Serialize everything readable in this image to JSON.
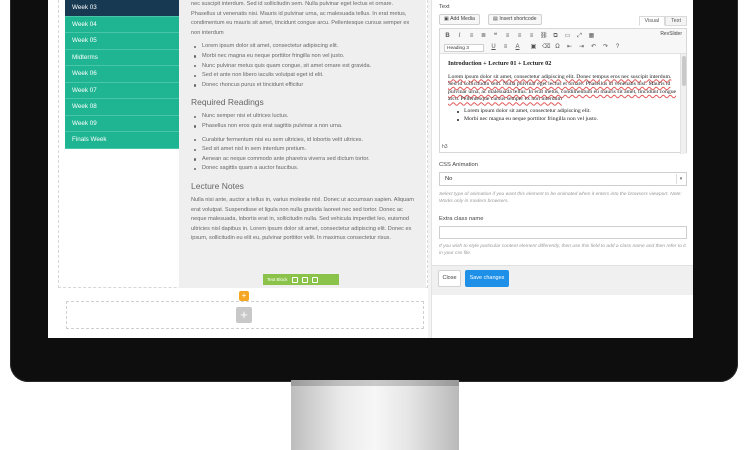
{
  "sidebar": {
    "weeks": [
      {
        "label": "Week 03",
        "active": true
      },
      {
        "label": "Week 04"
      },
      {
        "label": "Week 05"
      },
      {
        "label": "Midterms"
      },
      {
        "label": "Week 06"
      },
      {
        "label": "Week 07"
      },
      {
        "label": "Week 08"
      },
      {
        "label": "Week 09"
      },
      {
        "label": "Finals Week"
      }
    ]
  },
  "content": {
    "intro_text": "nec suscipit interdum. Sed id sollicitudin sem. Nulla pulvinar eget lectus et ornare. Phasellus ut venenatis nisi. Mauris id pulvinar urna, ac malesuada tellus. In erat metus, condimentum eu mauris sit amet, tincidunt congue arcu. Pellentesque cursus semper ex non interdum",
    "list1": [
      "Lorem ipsum dolor sit amet, consectetur adipiscing elit.",
      "Morbi nec magna eu neque porttitor fringilla non vel justo.",
      "Nunc pulvinar metus quis quam congue, sit amet ornare est gravida.",
      "Sed et ante non libero iaculis volutpat eget id elit.",
      "Donec rhoncus purus et tincidunt efficitur"
    ],
    "required_heading": "Required Readings",
    "list2": [
      "Nunc semper nisi et ultrices luctus.",
      "Phasellus non eros quis erat sagittis pulvinar a non urna."
    ],
    "list3": [
      "Curabitur fermentum nisi eu sem ultricies, id lobortis velit ultrices.",
      "Sed sit amet nisl in sem interdum pretium.",
      "Aenean ac neque commodo ante pharetra viverra sed dictum tortor.",
      "Donec sagittis quam a auctor faucibus."
    ],
    "notes_heading": "Lecture Notes",
    "notes_text": "Nulla nisi ante, auctor a tellus in, varius molestie nisl. Donec ut accumsan sapien. Aliquam erat volutpat. Suspendisse et ligula non nulla gravida laoreet nec sed tortor. Donec ac neque malesuada, lobortis erat in, sollicitudin nulla. Sed vehicula imperdiet leo, euismod ultricies nisl dapibus in. Lorem ipsum dolor sit amet, consectetur adipiscing elit. Donec ex ipsum, sollicitudin eu elit eu, pulvinar porttitor velit. In maximus consectetur risus.",
    "mini_toolbar_label": "Text Block"
  },
  "panel": {
    "text_label": "Text",
    "add_media": "Add Media",
    "insert_shortcode": "Insert shortcode",
    "tab_visual": "Visual",
    "tab_text": "Text",
    "format_select": "Heading 3",
    "revslider": "RevSlider",
    "editor_heading": "Introduction + Lecture 01 + Lecture 02",
    "editor_para": "Lorem ipsum dolor sit amet, consectetur adipiscing elit. Donec tempus eros nec suscipit interdum. Sed id sollicitudin sem. Nulla pulvinar eget lectus et ornare. Phasellus ut venenatis nisi. Mauris id pulvinar urna, ac malesuada tellus. In erat metus, condimentum eu mauris sit amet, tincidunt congue arcu. Pellentesque cursus semper ex non interdum",
    "editor_list": [
      "Lorem ipsum dolor sit amet, consectetur adipiscing elit.",
      "Morbi nec magna eu neque porttitor fringilla non vel justo."
    ],
    "editor_path": "h3",
    "css_anim_label": "CSS Animation",
    "css_anim_value": "No",
    "css_anim_help": "Select type of animation if you want this element to be animated when it enters into the browsers viewport. Note: Works only in modern browsers.",
    "extra_class_label": "Extra class name",
    "extra_class_help": "If you wish to style particular content element differently, then use this field to add a class name and then refer to it in your css file.",
    "close_btn": "Close",
    "save_btn": "Save changes"
  },
  "colors": {
    "week_green": "#1fb592",
    "week_active": "#173a52",
    "save_blue": "#1e90e8",
    "mini_toolbar_green": "#8bc34a",
    "add_orange": "#f5a623"
  }
}
